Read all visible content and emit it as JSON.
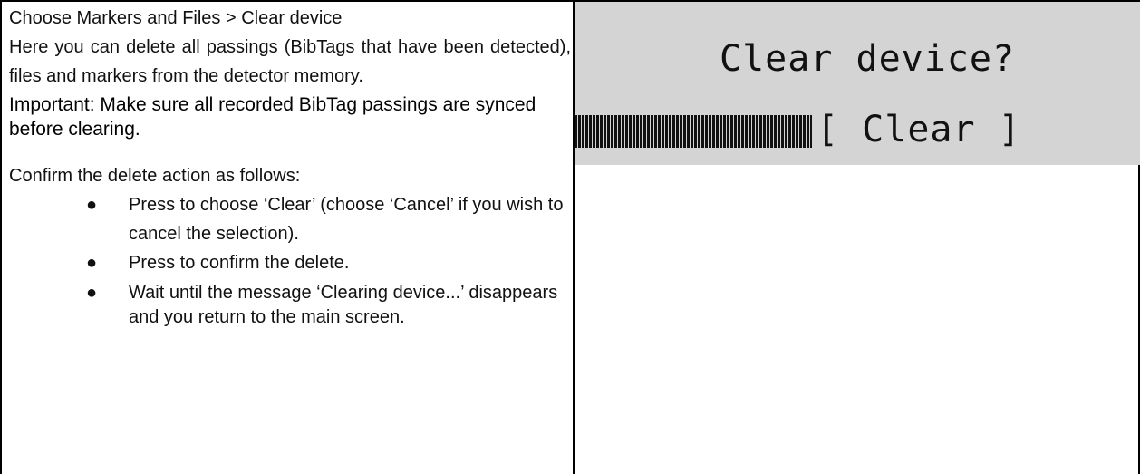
{
  "left": {
    "heading": "Choose Markers and Files > Clear device",
    "intro": "Here you can delete all passings (BibTags that have been detected), files and markers from the detector memory.",
    "important": "Important: Make sure all recorded BibTag passings are synced before clearing.",
    "confirm_heading": "Confirm the delete action as follows:",
    "steps": [
      "Press to choose ‘Clear’ (choose ‘Cancel’ if you wish to cancel the selection).",
      "Press to confirm the delete.",
      "Wait until the message ‘Clearing device...’ disappears and you return to the main screen."
    ]
  },
  "lcd": {
    "title": "Clear device?",
    "option": "[ Clear  ]"
  }
}
